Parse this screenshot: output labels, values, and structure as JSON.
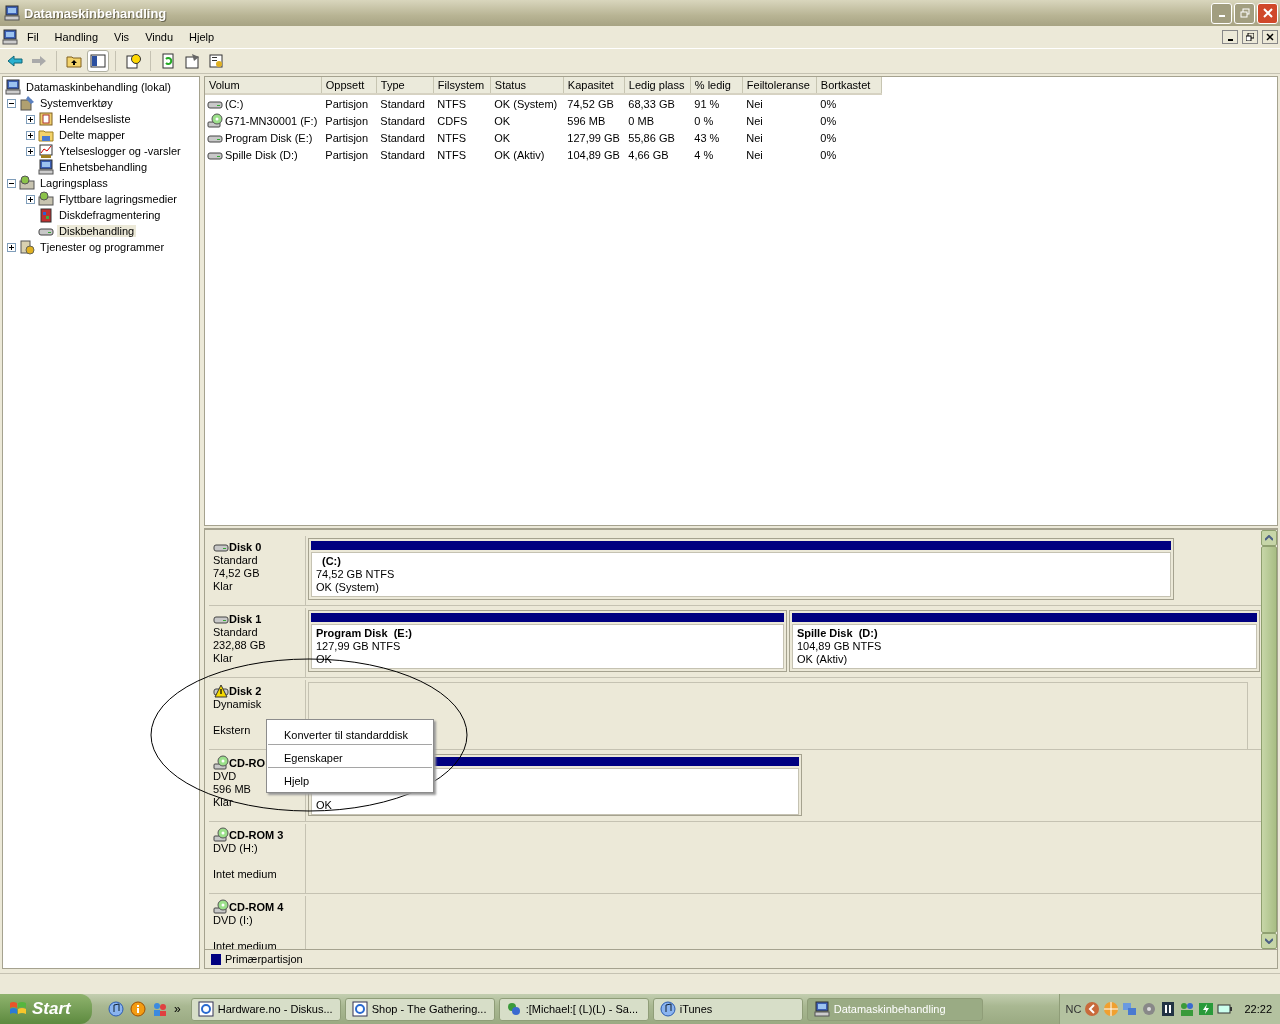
{
  "window": {
    "title": "Datamaskinbehandling"
  },
  "menu": [
    "Fil",
    "Handling",
    "Vis",
    "Vindu",
    "Hjelp"
  ],
  "tree": [
    {
      "label": "Datamaskinbehandling (lokal)",
      "selected": false,
      "children": [
        {
          "label": "Systemverktøy",
          "expanded": true,
          "selected": false,
          "children": [
            {
              "label": "Hendelsesliste",
              "expanded": false,
              "selected": false
            },
            {
              "label": "Delte mapper",
              "expanded": false,
              "selected": false
            },
            {
              "label": "Ytelseslogger og -varsler",
              "expanded": false,
              "selected": false
            },
            {
              "label": "Enhetsbehandling",
              "selected": false
            }
          ]
        },
        {
          "label": "Lagringsplass",
          "expanded": true,
          "selected": false,
          "children": [
            {
              "label": "Flyttbare lagringsmedier",
              "expanded": false,
              "selected": false
            },
            {
              "label": "Diskdefragmentering",
              "selected": false
            },
            {
              "label": "Diskbehandling",
              "selected": true
            }
          ]
        },
        {
          "label": "Tjenester og programmer",
          "expanded": false,
          "selected": false
        }
      ]
    }
  ],
  "volumes": {
    "columns": [
      "Volum",
      "Oppsett",
      "Type",
      "Filsystem",
      "Status",
      "Kapasitet",
      "Ledig plass",
      "% ledig",
      "Feiltoleranse",
      "Bortkastet"
    ],
    "rows": [
      {
        "kind": "hdd",
        "cells": [
          "(C:)",
          "Partisjon",
          "Standard",
          "NTFS",
          "OK (System)",
          "74,52 GB",
          "68,33 GB",
          "91 %",
          "Nei",
          "0%"
        ]
      },
      {
        "kind": "cd",
        "cells": [
          "G71-MN30001 (F:)",
          "Partisjon",
          "Standard",
          "CDFS",
          "OK",
          "596 MB",
          "0 MB",
          "0 %",
          "Nei",
          "0%"
        ]
      },
      {
        "kind": "hdd",
        "cells": [
          "Program Disk (E:)",
          "Partisjon",
          "Standard",
          "NTFS",
          "OK",
          "127,99 GB",
          "55,86 GB",
          "43 %",
          "Nei",
          "0%"
        ]
      },
      {
        "kind": "hdd",
        "cells": [
          "Spille Disk (D:)",
          "Partisjon",
          "Standard",
          "NTFS",
          "OK (Aktiv)",
          "104,89 GB",
          "4,66 GB",
          "4 %",
          "Nei",
          "0%"
        ]
      }
    ]
  },
  "disks": [
    {
      "kind": "disk",
      "name": "Disk 0",
      "type": "Standard",
      "capacity": "74,52 GB",
      "state": "Klar",
      "partitions": [
        {
          "name": "(C:)",
          "size": "74,52 GB NTFS",
          "status": "OK (System)"
        }
      ]
    },
    {
      "kind": "disk",
      "name": "Disk 1",
      "type": "Standard",
      "capacity": "232,88 GB",
      "state": "Klar",
      "partitions": [
        {
          "name": "Program Disk  (E:)",
          "size": "127,99 GB NTFS",
          "status": "OK"
        },
        {
          "name": "Spille Disk  (D:)",
          "size": "104,89 GB NTFS",
          "status": "OK (Aktiv)"
        }
      ]
    },
    {
      "kind": "foreign-disk",
      "name": "Disk 2",
      "type": "Dynamisk",
      "state": "Ekstern"
    },
    {
      "kind": "cdrom",
      "name": "CD-RO",
      "type": "DVD",
      "capacity": "596 MB",
      "state": "Klar",
      "partitions": [
        {
          "status": "OK"
        }
      ]
    },
    {
      "kind": "cdrom",
      "name": "CD-ROM 3",
      "type": "DVD (H:)",
      "state": "Intet medium"
    },
    {
      "kind": "cdrom",
      "name": "CD-ROM 4",
      "type": "DVD (I:)",
      "state": "Intet medium"
    }
  ],
  "legend": [
    {
      "label": "Primærpartisjon",
      "color": "#000080"
    }
  ],
  "context_menu": {
    "items": [
      "Konverter til standarddisk",
      "Egenskaper",
      "Hjelp"
    ]
  },
  "taskbar": {
    "start": "Start",
    "overflow": "»",
    "tasks": [
      {
        "kind": "browser",
        "label": "Hardware.no - Diskus...",
        "selected": false
      },
      {
        "kind": "browser",
        "label": "Shop - The Gathering...",
        "selected": false
      },
      {
        "kind": "chat",
        "label": ":[Michael:[ (L)(L) - Sa...",
        "selected": false
      },
      {
        "kind": "music",
        "label": "iTunes",
        "selected": false
      },
      {
        "kind": "computer",
        "label": "Datamaskinbehandling",
        "selected": true
      }
    ],
    "tray_label": "NC",
    "clock": "22:22"
  }
}
